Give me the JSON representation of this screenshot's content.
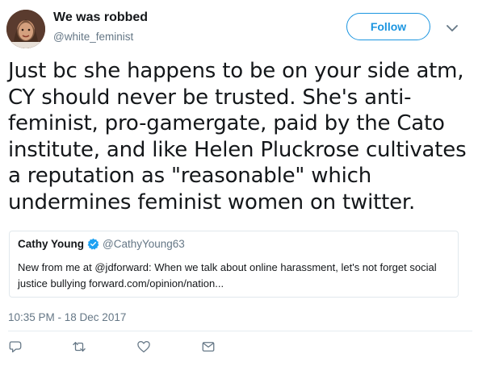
{
  "header": {
    "display_name": "We was robbed",
    "handle": "@white_feminist",
    "follow_label": "Follow"
  },
  "tweet": {
    "text": "Just bc she happens to be on your side atm, CY should never be trusted. She's anti-feminist, pro-gamergate, paid by the Cato institute, and like Helen Pluckrose cultivates a reputation as \"reasonable\" which undermines feminist women on twitter.",
    "timestamp": "10:35 PM - 18 Dec 2017"
  },
  "quote": {
    "name": "Cathy Young",
    "handle": "@CathyYoung63",
    "text": "New from me at @jdforward: When we talk about online harassment, let's not forget social justice bullying  forward.com/opinion/nation..."
  },
  "actions": {
    "icons": [
      "reply-icon",
      "retweet-icon",
      "like-icon",
      "message-icon"
    ]
  },
  "colors": {
    "accent": "#1b95e0",
    "secondary_text": "#657786",
    "border": "#e1e8ed",
    "verified": "#1da1f2"
  }
}
